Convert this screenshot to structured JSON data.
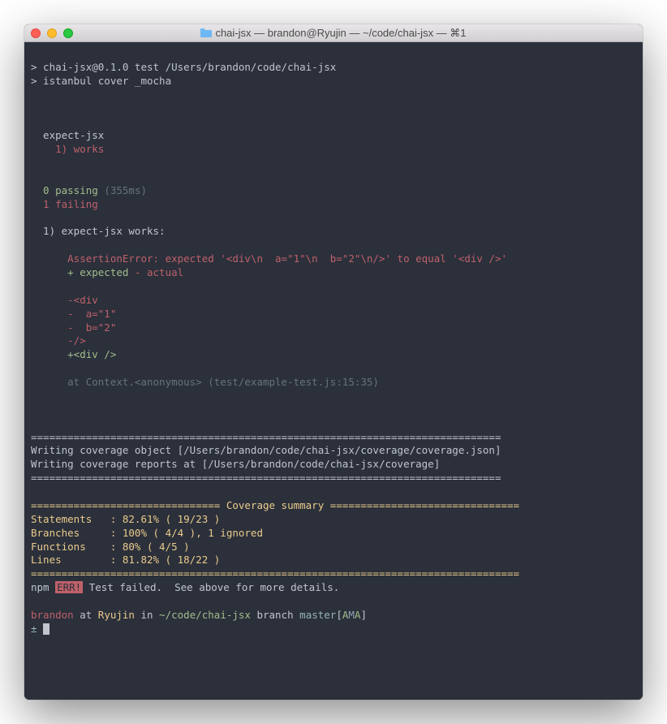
{
  "titlebar": {
    "title": "chai-jsx — brandon@Ryujin — ~/code/chai-jsx — ⌘1"
  },
  "lines": {
    "prompt1": "> chai-jsx@0.1.0 test /Users/brandon/code/chai-jsx",
    "prompt2": "> istanbul cover _mocha",
    "suite": "  expect-jsx",
    "test1": "    1) works",
    "passing_n": "  0 passing",
    "passing_time": " (355ms)",
    "failing": "  1 failing",
    "failhdr": "  1) expect-jsx works:",
    "asserterr": "      AssertionError: expected '<div\\n  a=\"1\"\\n  b=\"2\"\\n/>' to equal '<div />'",
    "diffhdr_plus": "      + expected",
    "diffhdr_minus": " - actual",
    "d1": "      -<div",
    "d2": "      -  a=\"1\"",
    "d3": "      -  b=\"2\"",
    "d4": "      -/>",
    "d5": "      +<div />",
    "trace": "      at Context.<anonymous> (test/example-test.js:15:35)",
    "sep1": "=============================================================================",
    "cov1": "Writing coverage object [/Users/brandon/code/chai-jsx/coverage/coverage.json]",
    "cov2": "Writing coverage reports at [/Users/brandon/code/chai-jsx/coverage]",
    "sep2": "=============================================================================",
    "sumhdr": "=============================== Coverage summary ===============================",
    "stmt": "Statements   : 82.61% ( 19/23 )",
    "bran": "Branches     : 100% ( 4/4 ), 1 ignored",
    "func": "Functions    : 80% ( 4/5 )",
    "lns": "Lines        : 81.82% ( 18/22 )",
    "sep3": "================================================================================",
    "npm_pre": "npm ",
    "npm_err": "ERR!",
    "npm_post": " Test failed.  See above for more details.",
    "psuser": "brandon",
    "psat": " at ",
    "pshost": "Ryujin",
    "psin": " in ",
    "pspath": "~/code/chai-jsx",
    "psbranch_lbl": " branch ",
    "psbranch": "master",
    "psflags_open": "[",
    "psflags_a": "A",
    "psflags_m": "M",
    "psflags_a2": "A",
    "psflags_close": "]",
    "pssymbol": "± "
  }
}
